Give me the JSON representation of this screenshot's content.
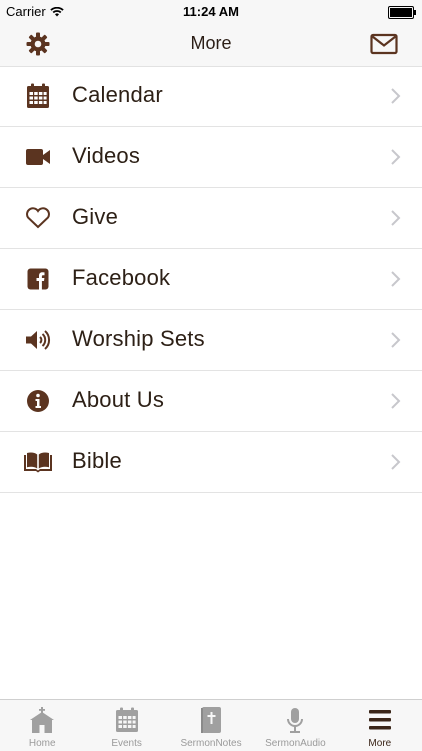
{
  "status_bar": {
    "carrier": "Carrier",
    "time": "11:24 AM"
  },
  "nav": {
    "title": "More",
    "left_icon": "gear-icon",
    "right_icon": "envelope-icon"
  },
  "menu": {
    "items": [
      {
        "label": "Calendar",
        "icon": "calendar-icon"
      },
      {
        "label": "Videos",
        "icon": "video-camera-icon"
      },
      {
        "label": "Give",
        "icon": "heart-icon"
      },
      {
        "label": "Facebook",
        "icon": "facebook-icon"
      },
      {
        "label": "Worship Sets",
        "icon": "speaker-icon"
      },
      {
        "label": "About Us",
        "icon": "info-icon"
      },
      {
        "label": "Bible",
        "icon": "book-icon"
      }
    ]
  },
  "tab_bar": {
    "tabs": [
      {
        "label": "Home",
        "icon": "church-icon",
        "active": false
      },
      {
        "label": "Events",
        "icon": "calendar-icon",
        "active": false
      },
      {
        "label": "SermonNotes",
        "icon": "bible-icon",
        "active": false
      },
      {
        "label": "SermonAudio",
        "icon": "microphone-icon",
        "active": false
      },
      {
        "label": "More",
        "icon": "menu-icon",
        "active": true
      }
    ]
  },
  "colors": {
    "accent": "#5b3420",
    "text": "#2d2016",
    "tab_inactive": "#9a9a9a",
    "divider": "#e3e3e3"
  }
}
